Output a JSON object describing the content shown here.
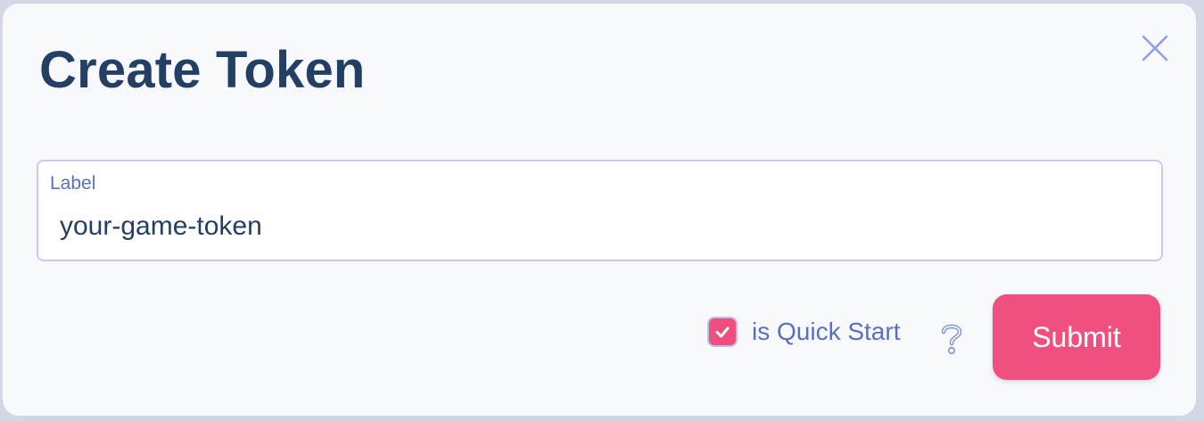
{
  "dialog": {
    "title": "Create Token",
    "close_icon": "close-icon"
  },
  "form": {
    "label_field": {
      "label": "Label",
      "value": "your-game-token"
    },
    "quick_start": {
      "label": "is Quick Start",
      "checked": true,
      "help_icon": "question-mark-icon"
    },
    "submit_label": "Submit"
  },
  "colors": {
    "accent": "#ef5080",
    "title": "#233f63",
    "label": "#5c6fbf",
    "border": "#c6cbf2"
  }
}
